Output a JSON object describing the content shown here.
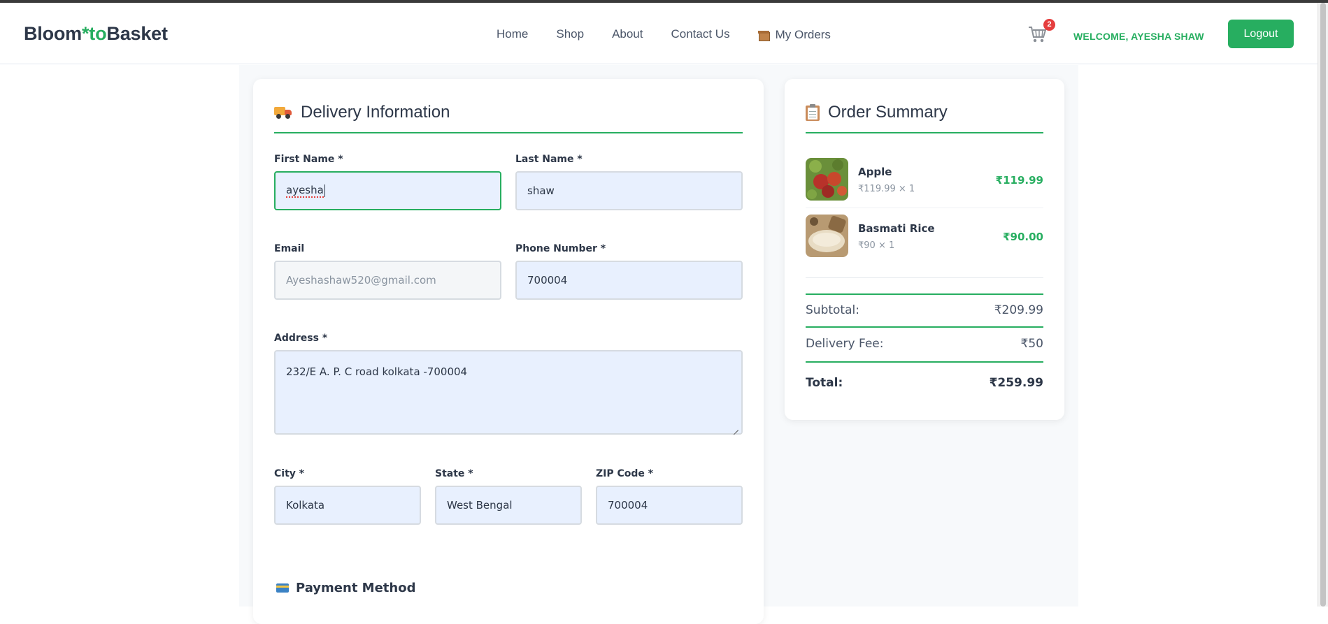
{
  "header": {
    "logo": {
      "part1": "Bloom",
      "accent": "*to",
      "part2": "Basket"
    },
    "nav": [
      "Home",
      "Shop",
      "About",
      "Contact Us"
    ],
    "my_orders": "My Orders",
    "cart_count": "2",
    "welcome": "WELCOME, AYESHA SHAW",
    "logout": "Logout"
  },
  "delivery": {
    "title": "Delivery Information",
    "first_name": {
      "label": "First Name *",
      "value": "ayesha"
    },
    "last_name": {
      "label": "Last Name *",
      "value": "shaw"
    },
    "email": {
      "label": "Email",
      "value": "Ayeshashaw520@gmail.com"
    },
    "phone": {
      "label": "Phone Number *",
      "value": "700004"
    },
    "address": {
      "label": "Address *",
      "value": "232/E A. P. C road kolkata -700004"
    },
    "city": {
      "label": "City *",
      "value": "Kolkata"
    },
    "state": {
      "label": "State *",
      "value": "West Bengal"
    },
    "zip": {
      "label": "ZIP Code *",
      "value": "700004"
    },
    "payment_title": "Payment Method"
  },
  "summary": {
    "title": "Order Summary",
    "items": [
      {
        "name": "Apple",
        "qty": "₹119.99 × 1",
        "price": "₹119.99"
      },
      {
        "name": "Basmati Rice",
        "qty": "₹90 × 1",
        "price": "₹90.00"
      }
    ],
    "subtotal_label": "Subtotal:",
    "subtotal": "₹209.99",
    "delivery_label": "Delivery Fee:",
    "delivery": "₹50",
    "total_label": "Total:",
    "total": "₹259.99"
  },
  "colors": {
    "accent": "#27ae60",
    "badge": "#e53e3e",
    "text": "#2d3748"
  },
  "icons": [
    "cart-icon",
    "box-icon",
    "truck-icon",
    "clipboard-icon",
    "credit-card-icon"
  ]
}
